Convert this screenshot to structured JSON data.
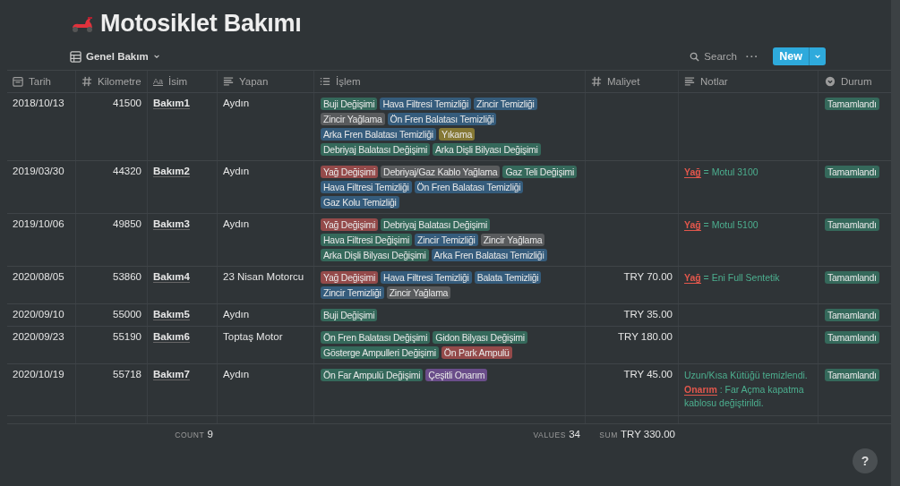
{
  "page": {
    "title": "Motosiklet Bakımı"
  },
  "view": {
    "label": "Genel Bakım"
  },
  "toolbar": {
    "search": "Search",
    "more": "···",
    "new_button": "New"
  },
  "columns": [
    {
      "label": "Tarih",
      "kind": "date"
    },
    {
      "label": "Kilometre",
      "kind": "number"
    },
    {
      "label": "İsim",
      "kind": "title",
      "icon_text": "Aa"
    },
    {
      "label": "Yapan",
      "kind": "text"
    },
    {
      "label": "İşlem",
      "kind": "multiselect"
    },
    {
      "label": "Maliyet",
      "kind": "number"
    },
    {
      "label": "Notlar",
      "kind": "text"
    },
    {
      "label": "Durum",
      "kind": "status"
    }
  ],
  "rows": [
    {
      "date": "2018/10/13",
      "km": "41500",
      "name": "Bakım1",
      "by": "Aydın",
      "tags": [
        {
          "label": "Buji Değişimi",
          "color": "#35695b"
        },
        {
          "label": "Hava Filtresi Temizliği",
          "color": "#355c7c"
        },
        {
          "label": "Zincir Temizliği",
          "color": "#355c7c"
        },
        {
          "label": "Zincir Yağlama",
          "color": "#595b5d"
        },
        {
          "label": "Ön Fren Balatası Temizliği",
          "color": "#355c7c"
        },
        {
          "label": "Arka Fren Balatası Temizliği",
          "color": "#355c7c"
        },
        {
          "label": "Yıkama",
          "color": "#857834"
        },
        {
          "label": "Debriyaj Balatası Değişimi",
          "color": "#35695b"
        },
        {
          "label": "Arka Dişli Bilyası Değişimi",
          "color": "#35695b"
        }
      ],
      "notes": [],
      "status": {
        "label": "Tamamlandı",
        "color": "#35695b"
      }
    },
    {
      "date": "2019/03/30",
      "km": "44320",
      "name": "Bakım2",
      "by": "Aydın",
      "tags": [
        {
          "label": "Yağ Değişimi",
          "color": "#944a4a"
        },
        {
          "label": "Debriyaj/Gaz Kablo Yağlama",
          "color": "#595b5d"
        },
        {
          "label": "Gaz Teli Değişimi",
          "color": "#35695b"
        },
        {
          "label": "Hava Filtresi Temizliği",
          "color": "#355c7c"
        },
        {
          "label": "Ön Fren Balatası Temizliği",
          "color": "#355c7c"
        },
        {
          "label": "Gaz Kolu Temizliği",
          "color": "#355c7c"
        }
      ],
      "notes": [
        [
          {
            "kind": "highlight",
            "text": "Yağ"
          },
          {
            "kind": "plain",
            "text": " = Motul 3100"
          }
        ]
      ],
      "status": {
        "label": "Tamamlandı",
        "color": "#35695b"
      }
    },
    {
      "date": "2019/10/06",
      "km": "49850",
      "name": "Bakım3",
      "by": "Aydın",
      "tags": [
        {
          "label": "Yağ Değişimi",
          "color": "#944a4a"
        },
        {
          "label": "Debriyaj Balatası Değişimi",
          "color": "#35695b"
        },
        {
          "label": "Hava Filtresi Değişimi",
          "color": "#35695b"
        },
        {
          "label": "Zincir Temizliği",
          "color": "#355c7c"
        },
        {
          "label": "Zincir Yağlama",
          "color": "#595b5d"
        },
        {
          "label": "Arka Dişli Bilyası Değişimi",
          "color": "#35695b"
        },
        {
          "label": "Arka Fren Balatası Temizliği",
          "color": "#355c7c"
        }
      ],
      "notes": [
        [
          {
            "kind": "highlight",
            "text": "Yağ"
          },
          {
            "kind": "plain",
            "text": " = Motul 5100"
          }
        ]
      ],
      "status": {
        "label": "Tamamlandı",
        "color": "#35695b"
      }
    },
    {
      "date": "2020/08/05",
      "km": "53860",
      "name": "Bakım4",
      "by": "23 Nisan Motorcu",
      "tags": [
        {
          "label": "Yağ Değişimi",
          "color": "#944a4a"
        },
        {
          "label": "Hava Filtresi Temizliği",
          "color": "#355c7c"
        },
        {
          "label": "Balata Temizliği",
          "color": "#355c7c"
        },
        {
          "label": "Zincir Temizliği",
          "color": "#355c7c"
        },
        {
          "label": "Zincir Yağlama",
          "color": "#595b5d"
        }
      ],
      "cost": "TRY 70.00",
      "notes": [
        [
          {
            "kind": "highlight",
            "text": "Yağ"
          },
          {
            "kind": "plain",
            "text": " = Eni Full Sentetik"
          }
        ]
      ],
      "status": {
        "label": "Tamamlandı",
        "color": "#35695b"
      }
    },
    {
      "date": "2020/09/10",
      "km": "55000",
      "name": "Bakım5",
      "by": "Aydın",
      "tags": [
        {
          "label": "Buji Değişimi",
          "color": "#35695b"
        }
      ],
      "cost": "TRY 35.00",
      "notes": [],
      "status": {
        "label": "Tamamlandı",
        "color": "#35695b"
      }
    },
    {
      "date": "2020/09/23",
      "km": "55190",
      "name": "Bakım6",
      "by": "Toptaş Motor",
      "tags": [
        {
          "label": "Ön Fren Balatası Değişimi",
          "color": "#35695b"
        },
        {
          "label": "Gidon Bilyası Değişimi",
          "color": "#35695b"
        },
        {
          "label": "Gösterge Ampulleri Değişimi",
          "color": "#35695b"
        },
        {
          "label": "Ön Park Ampulü",
          "color": "#944a4a"
        }
      ],
      "cost": "TRY 180.00",
      "notes": [],
      "status": {
        "label": "Tamamlandı",
        "color": "#35695b"
      }
    },
    {
      "date": "2020/10/19",
      "km": "55718",
      "name": "Bakım7",
      "by": "Aydın",
      "tags": [
        {
          "label": "Ön Far Ampulü Değişimi",
          "color": "#35695b"
        },
        {
          "label": "Çeşitli Onarım",
          "color": "#6a4d8a"
        }
      ],
      "cost": "TRY 45.00",
      "notes": [
        [
          {
            "kind": "plain",
            "text": "Uzun/Kısa Kütüğü temizlendi."
          }
        ],
        [
          {
            "kind": "highlight",
            "text": "Onarım"
          },
          {
            "kind": "plain",
            "text": " : Far Açma kapatma kablosu değiştirildi."
          }
        ]
      ],
      "status": {
        "label": "Tamamlandı",
        "color": "#35695b"
      }
    }
  ],
  "footer": {
    "count_label": "COUNT",
    "count": "9",
    "values_label": "VALUES",
    "values": "34",
    "sum_label": "SUM",
    "sum": "TRY 330.00"
  },
  "help_button": "?"
}
